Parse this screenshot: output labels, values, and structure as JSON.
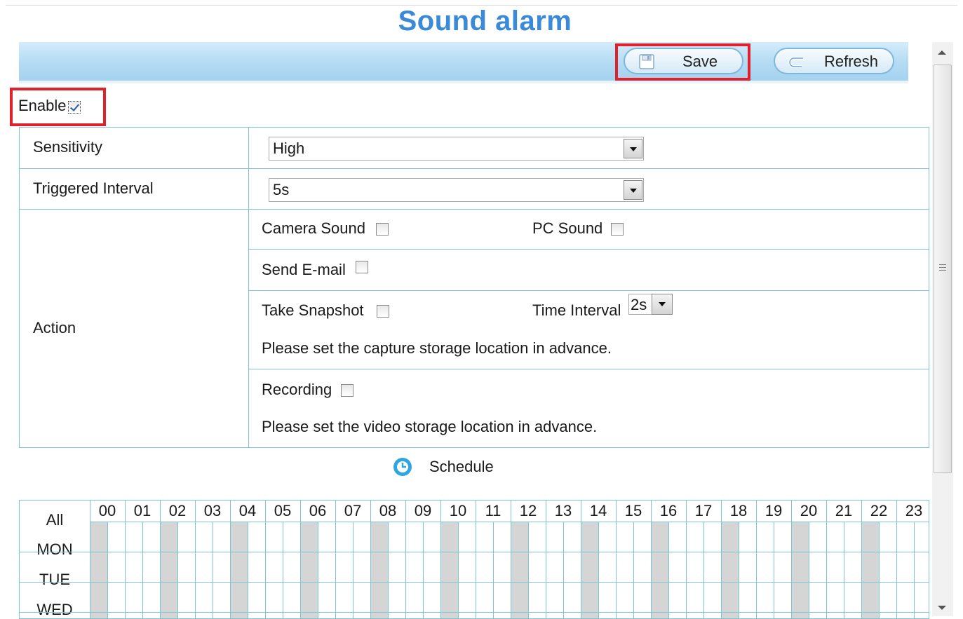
{
  "page": {
    "title": "Sound alarm"
  },
  "toolbar": {
    "save_label": "Save",
    "refresh_label": "Refresh"
  },
  "enable": {
    "label": "Enable",
    "checked": true
  },
  "form": {
    "sensitivity_label": "Sensitivity",
    "sensitivity_value": "High",
    "triggered_interval_label": "Triggered Interval",
    "triggered_interval_value": "5s",
    "action_label": "Action",
    "camera_sound_label": "Camera Sound",
    "pc_sound_label": "PC Sound",
    "send_email_label": "Send E-mail",
    "take_snapshot_label": "Take Snapshot",
    "time_interval_label": "Time Interval",
    "time_interval_value": "2s",
    "snapshot_note": "Please set the capture storage location in advance.",
    "recording_label": "Recording",
    "recording_note": "Please set the video storage location in advance."
  },
  "schedule": {
    "title": "Schedule",
    "all_label": "All",
    "days": [
      "MON",
      "TUE",
      "WED"
    ],
    "hours": [
      "00",
      "01",
      "02",
      "03",
      "04",
      "05",
      "06",
      "07",
      "08",
      "09",
      "10",
      "11",
      "12",
      "13",
      "14",
      "15",
      "16",
      "17",
      "18",
      "19",
      "20",
      "21",
      "22",
      "23"
    ]
  },
  "colors": {
    "title": "#3a8ad8",
    "highlight": "#e0202a",
    "grid_line": "#7cc4d8",
    "shade": "#d5d5d5"
  },
  "icons": {
    "save": "floppy-disk-icon",
    "refresh": "refresh-arrow-icon",
    "schedule": "clock-icon"
  }
}
